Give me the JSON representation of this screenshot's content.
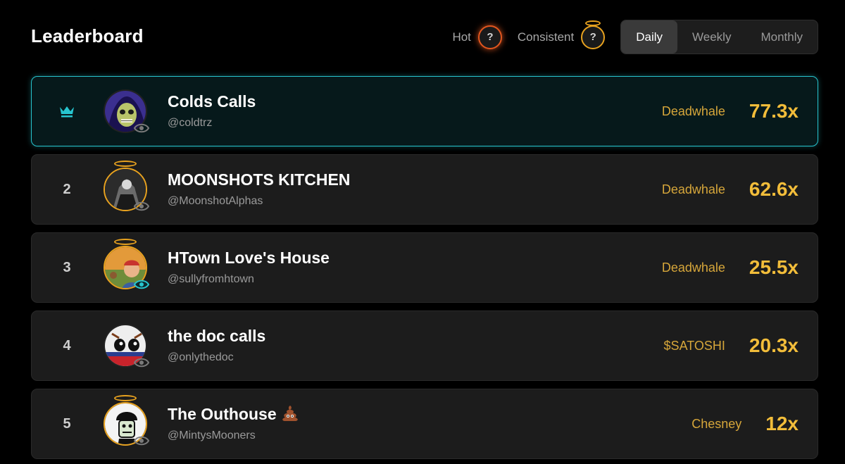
{
  "header": {
    "title": "Leaderboard",
    "filters": {
      "hot_label": "Hot",
      "consistent_label": "Consistent",
      "help_glyph": "?"
    },
    "tabs": [
      {
        "label": "Daily",
        "active": true
      },
      {
        "label": "Weekly",
        "active": false
      },
      {
        "label": "Monthly",
        "active": false
      }
    ]
  },
  "colors": {
    "accent_teal": "#27c5cf",
    "gold": "#f2bd3a",
    "hot": "#e2561e"
  },
  "rows": [
    {
      "rank": "",
      "rank_icon": "crown-icon",
      "name": "Colds Calls",
      "handle": "@coldtrz",
      "token": "Deadwhale",
      "multiplier": "77.3x",
      "halo": false
    },
    {
      "rank": "2",
      "name": "MOONSHOTS KITCHEN",
      "handle": "@MoonshotAlphas",
      "token": "Deadwhale",
      "multiplier": "62.6x",
      "halo": true
    },
    {
      "rank": "3",
      "name": "HTown Love's House",
      "handle": "@sullyfromhtown",
      "token": "Deadwhale",
      "multiplier": "25.5x",
      "halo": true
    },
    {
      "rank": "4",
      "name": "the doc calls",
      "handle": "@onlythedoc",
      "token": "$SATOSHI",
      "multiplier": "20.3x",
      "halo": false
    },
    {
      "rank": "5",
      "name": "The Outhouse",
      "name_icon": "poop-emoji-icon",
      "handle": "@MintysMooners",
      "token": "Chesney",
      "multiplier": "12x",
      "halo": true
    }
  ]
}
